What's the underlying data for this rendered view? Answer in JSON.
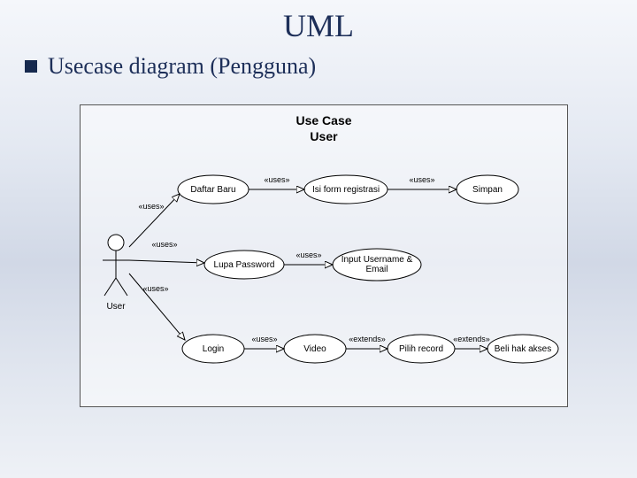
{
  "slide": {
    "title": "UML",
    "bullet": "Usecase diagram (Pengguna)"
  },
  "diagram": {
    "title1": "Use Case",
    "title2": "User",
    "actor": "User",
    "usecases": {
      "daftar_baru": "Daftar Baru",
      "isi_form": "Isi form registrasi",
      "simpan": "Simpan",
      "lupa_password": "Lupa Password",
      "input_user_email": "Input Username & Email",
      "login": "Login",
      "video": "Video",
      "pilih_record": "Pilih record",
      "beli_hak_akses": "Beli hak akses"
    },
    "stereotypes": {
      "uses": "«uses»",
      "extends": "«extends»"
    },
    "relations": [
      {
        "from": "actor",
        "to": "daftar_baru",
        "label": "uses"
      },
      {
        "from": "actor",
        "to": "lupa_password",
        "label": "uses"
      },
      {
        "from": "actor",
        "to": "login",
        "label": "uses"
      },
      {
        "from": "daftar_baru",
        "to": "isi_form",
        "label": "uses"
      },
      {
        "from": "isi_form",
        "to": "simpan",
        "label": "uses"
      },
      {
        "from": "lupa_password",
        "to": "input_user_email",
        "label": "uses"
      },
      {
        "from": "login",
        "to": "video",
        "label": "uses"
      },
      {
        "from": "video",
        "to": "pilih_record",
        "label": "extends"
      },
      {
        "from": "pilih_record",
        "to": "beli_hak_akses",
        "label": "extends"
      }
    ]
  }
}
